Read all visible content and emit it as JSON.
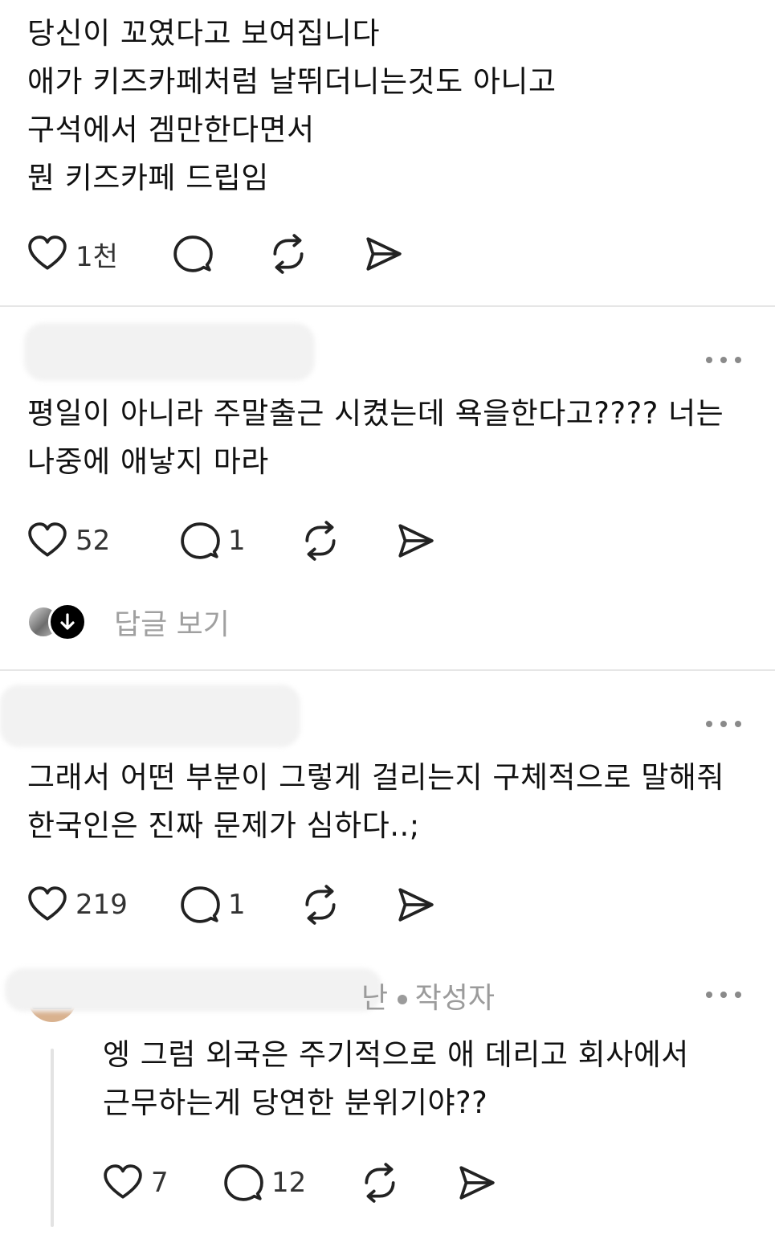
{
  "post1": {
    "lines": [
      "당신이 꼬였다고 보여집니다",
      "애가 키즈카페처럼 날뛰더니는것도 아니고",
      "구석에서 겜만한다면서",
      "뭔 키즈카페 드립임"
    ],
    "likes": "1천"
  },
  "comment1": {
    "lines": [
      "평일이 아니라 주말출근 시켰는데 욕을한다고???? 너는",
      "나중에 애낳지 마라"
    ],
    "likes": "52",
    "replies": "1",
    "view_replies_label": "답글 보기"
  },
  "comment2": {
    "lines": [
      "그래서 어떤 부분이 그렇게 걸리는지 구체적으로 말해줘",
      "한국인은 진짜 문제가 심하다..;"
    ],
    "likes": "219",
    "replies": "1"
  },
  "reply1": {
    "author_partial": "난",
    "author_tag": "작성자",
    "lines": [
      "엥 그럼 외국은 주기적으로 애 데리고 회사에서",
      "근무하는게 당연한 분위기야??"
    ],
    "likes": "7",
    "replies": "12"
  },
  "icons": {
    "like": "heart-icon",
    "comment": "comment-bubble-icon",
    "repost": "repost-icon",
    "share": "send-icon",
    "more": "more-dots-icon",
    "expand": "arrow-down-icon"
  },
  "colors": {
    "text": "#111111",
    "muted": "#a0a0a0",
    "divider": "#e6e6e6",
    "icon": "#222222"
  }
}
